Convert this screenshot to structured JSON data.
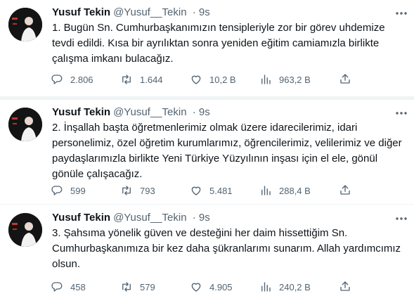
{
  "tweets": [
    {
      "name": "Yusuf Tekin",
      "handle": "@Yusuf__Tekin",
      "time": "· 9s",
      "text": "1. Bugün Sn. Cumhurbaşkanımızın tensipleriyle zor bir görev uhdemize tevdi edildi. Kısa bir ayrılıktan sonra yeniden eğitim camiamızla birlikte çalışma imkanı bulacağız.",
      "replies": "2.806",
      "retweets": "1.644",
      "likes": "10,2 B",
      "views": "963,2 B"
    },
    {
      "name": "Yusuf Tekin",
      "handle": "@Yusuf__Tekin",
      "time": "· 9s",
      "text": "2. İnşallah başta öğretmenlerimiz olmak üzere idarecilerimiz, idari personelimiz, özel öğretim kurumlarımız, öğrencilerimiz, velilerimiz ve diğer paydaşlarımızla birlikte Yeni Türkiye Yüzyılının inşası için el ele, gönül gönüle çalışacağız.",
      "replies": "599",
      "retweets": "793",
      "likes": "5.481",
      "views": "288,4 B"
    },
    {
      "name": "Yusuf Tekin",
      "handle": "@Yusuf__Tekin",
      "time": "· 9s",
      "text": "3. Şahsıma yönelik güven ve desteğini her daim hissettiğim Sn. Cumhurbaşkanımıza bir kez daha şükranlarımı sunarım. Allah yardımcımız olsun.",
      "replies": "458",
      "retweets": "579",
      "likes": "4.905",
      "views": "240,2 B"
    }
  ],
  "icons": [
    "more-icon",
    "reply-icon",
    "retweet-icon",
    "like-icon",
    "views-icon",
    "share-icon"
  ],
  "colors": {
    "text": "#0f1419",
    "secondary": "#536471",
    "separator": "#eff3f4",
    "avatar_bg": "#141414",
    "avatar_accent": "#c0392b"
  }
}
